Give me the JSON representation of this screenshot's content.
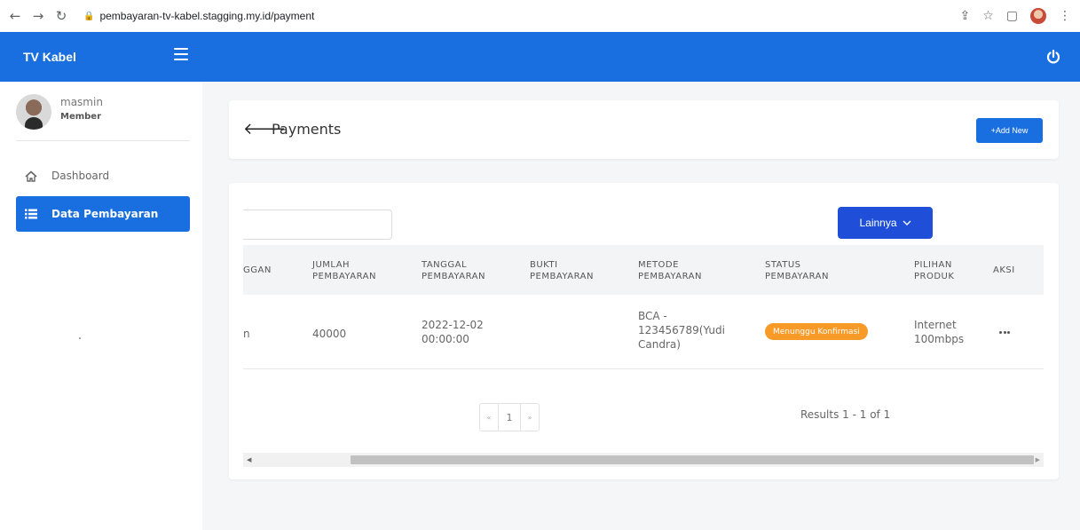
{
  "browser": {
    "url": "pembayaran-tv-kabel.stagging.my.id/payment"
  },
  "app": {
    "brand": "TV Kabel"
  },
  "user": {
    "name": "masmin",
    "role": "Member"
  },
  "sidebar": {
    "items": [
      {
        "label": "Dashboard",
        "icon": "home-icon"
      },
      {
        "label": "Data Pembayaran",
        "icon": "list-icon"
      }
    ]
  },
  "page": {
    "title": "Payments",
    "add_button": "+Add New"
  },
  "toolbar": {
    "lainnya_label": "Lainnya"
  },
  "table": {
    "columns": [
      [
        "GGAN"
      ],
      [
        "JUMLAH",
        "PEMBAYARAN"
      ],
      [
        "TANGGAL",
        "PEMBAYARAN"
      ],
      [
        "BUKTI",
        "PEMBAYARAN"
      ],
      [
        "METODE",
        "PEMBAYARAN"
      ],
      [
        "STATUS",
        "PEMBAYARAN"
      ],
      [
        "PILIHAN",
        "PRODUK"
      ],
      [
        "AKSI"
      ]
    ],
    "rows": [
      {
        "pelanggan": "n",
        "jumlah": "40000",
        "tanggal": [
          "2022-12-02",
          "00:00:00"
        ],
        "bukti": "",
        "metode": [
          "BCA -",
          "123456789(Yudi",
          "Candra)"
        ],
        "status": "Menunggu Konfirmasi",
        "produk": [
          "Internet",
          "100mbps"
        ]
      }
    ]
  },
  "pagination": {
    "prev": "«",
    "current": "1",
    "next": "»",
    "results": "Results 1 - 1 of 1"
  },
  "colors": {
    "primary": "#1a6fe0",
    "lainnya": "#1f4fd8",
    "status_pending": "#f79a27"
  }
}
